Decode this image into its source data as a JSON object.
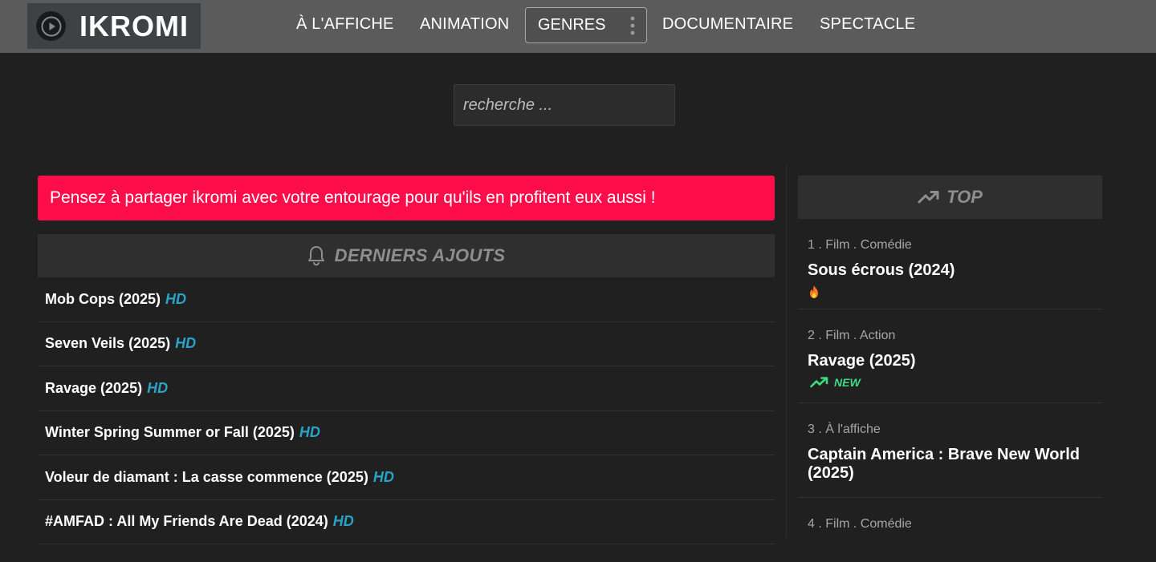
{
  "brand": {
    "name": "IKROMI",
    "logo_icon": "play-circle-icon"
  },
  "nav": {
    "items": [
      "À L'AFFICHE",
      "ANIMATION",
      "DOCUMENTAIRE",
      "SPECTACLE"
    ],
    "genres_label": "GENRES",
    "genres_icon": "vertical-dots-icon"
  },
  "search": {
    "placeholder": "recherche ...",
    "value": ""
  },
  "alert": {
    "text": "Pensez à partager ikromi avec votre entourage pour qu'ils en profitent eux aussi !",
    "color": "#fe0d4b"
  },
  "latest": {
    "title": "DERNIERS AJOUTS",
    "icon": "bell-icon",
    "quality_color": "#2aa3c8",
    "items": [
      {
        "title": "Mob Cops (2025)",
        "quality": "HD"
      },
      {
        "title": "Seven Veils (2025)",
        "quality": "HD"
      },
      {
        "title": "Ravage (2025)",
        "quality": "HD"
      },
      {
        "title": "Winter Spring Summer or Fall (2025)",
        "quality": "HD"
      },
      {
        "title": "Voleur de diamant : La casse commence (2025)",
        "quality": "HD"
      },
      {
        "title": "#AMFAD : All My Friends Are Dead (2024)",
        "quality": "HD"
      }
    ]
  },
  "top": {
    "title": "TOP",
    "icon": "trending-up-icon",
    "items": [
      {
        "meta": "1 . Film . Comédie",
        "title": "Sous écrous (2024)",
        "badge_icon": "fire-icon",
        "badge_text": ""
      },
      {
        "meta": "2 . Film . Action",
        "title": "Ravage (2025)",
        "badge_icon": "trending-up-icon",
        "badge_text": "NEW",
        "badge_color": "#3ddc84"
      },
      {
        "meta": "3 . À l'affiche",
        "title": "Captain America : Brave New World (2025)",
        "badge_icon": "",
        "badge_text": ""
      },
      {
        "meta": "4 . Film . Comédie",
        "title": "",
        "badge_icon": "",
        "badge_text": ""
      }
    ]
  }
}
